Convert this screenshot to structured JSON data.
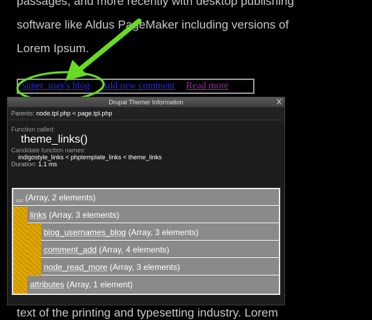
{
  "article": {
    "line1": "passages, and more recently with desktop publishing",
    "line2": "software like Aldus PageMaker including versions of",
    "line3": "Lorem Ipsum.",
    "line4": "text of the printing and typesetting industry. Lorem"
  },
  "links": {
    "blog": "super_user's blog",
    "add_comment": "Add new comment",
    "read_more": "Read more"
  },
  "themer": {
    "title": "Drupal Themer Information",
    "close": "X",
    "parents_label": "Parents:",
    "parents_value": "node.tpl.php < page.tpl.php",
    "function_called_label": "Function called:",
    "function_name": "theme_links()",
    "candidates_label": "Candidate function names:",
    "candidates": "indigostyle_links < phptemplate_links < theme_links",
    "duration_label": "Duration:",
    "duration_value": "1.1 ms",
    "tree": {
      "root_key": "...",
      "root_desc": "(Array, 2 elements)",
      "links_key": "links",
      "links_desc": "(Array, 3 elements)",
      "item1_key": "blog_usernames_blog",
      "item1_desc": "(Array, 3 elements)",
      "item2_key": "comment_add",
      "item2_desc": "(Array, 4 elements)",
      "item3_key": "node_read_more",
      "item3_desc": "(Array, 3 elements)",
      "attr_key": "attributes",
      "attr_desc": "(Array, 1 element)"
    }
  },
  "colors": {
    "annotation": "#66dd22",
    "tree_highlight": "#e2a800"
  }
}
